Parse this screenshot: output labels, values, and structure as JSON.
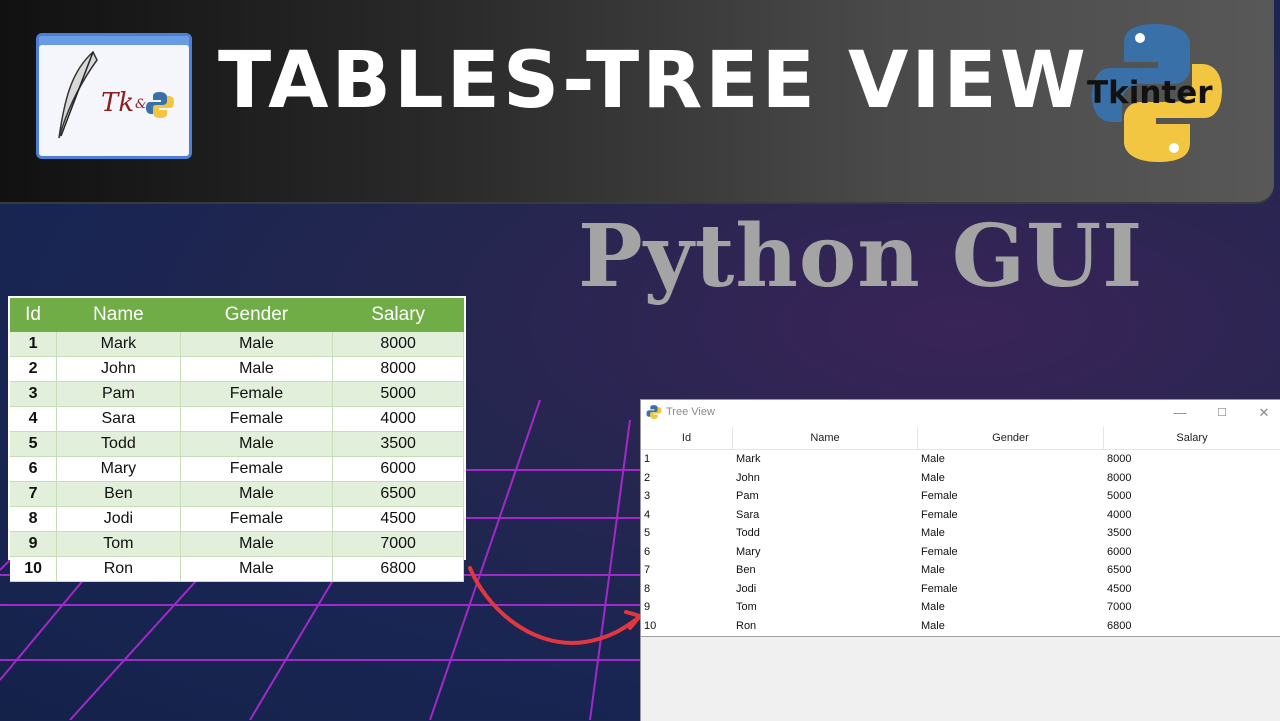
{
  "banner": {
    "title": "TABLES-TREE VIEW",
    "logo_text": "Tk",
    "logo_amp": "&",
    "badge": "Tkinter"
  },
  "subtitle": "Python GUI",
  "excel_table": {
    "headers": [
      "Id",
      "Name",
      "Gender",
      "Salary"
    ],
    "header_color": "#70ad47",
    "stripe_color": "#e2efda",
    "rows": [
      [
        "1",
        "Mark",
        "Male",
        "8000"
      ],
      [
        "2",
        "John",
        "Male",
        "8000"
      ],
      [
        "3",
        "Pam",
        "Female",
        "5000"
      ],
      [
        "4",
        "Sara",
        "Female",
        "4000"
      ],
      [
        "5",
        "Todd",
        "Male",
        "3500"
      ],
      [
        "6",
        "Mary",
        "Female",
        "6000"
      ],
      [
        "7",
        "Ben",
        "Male",
        "6500"
      ],
      [
        "8",
        "Jodi",
        "Female",
        "4500"
      ],
      [
        "9",
        "Tom",
        "Male",
        "7000"
      ],
      [
        "10",
        "Ron",
        "Male",
        "6800"
      ]
    ]
  },
  "window": {
    "title": "Tree View",
    "controls": {
      "minimize": "—",
      "maximize": "☐",
      "close": "✕"
    },
    "headers": [
      "Id",
      "Name",
      "Gender",
      "Salary"
    ],
    "rows": [
      [
        "1",
        "Mark",
        "Male",
        "8000"
      ],
      [
        "2",
        "John",
        "Male",
        "8000"
      ],
      [
        "3",
        "Pam",
        "Female",
        "5000"
      ],
      [
        "4",
        "Sara",
        "Female",
        "4000"
      ],
      [
        "5",
        "Todd",
        "Male",
        "3500"
      ],
      [
        "6",
        "Mary",
        "Female",
        "6000"
      ],
      [
        "7",
        "Ben",
        "Male",
        "6500"
      ],
      [
        "8",
        "Jodi",
        "Female",
        "4500"
      ],
      [
        "9",
        "Tom",
        "Male",
        "7000"
      ],
      [
        "10",
        "Ron",
        "Male",
        "6800"
      ]
    ]
  },
  "colors": {
    "arrow": "#e0383e",
    "grid": "#b12ad6",
    "title": "#ffffff",
    "subtitle": "#a4a4a4"
  }
}
